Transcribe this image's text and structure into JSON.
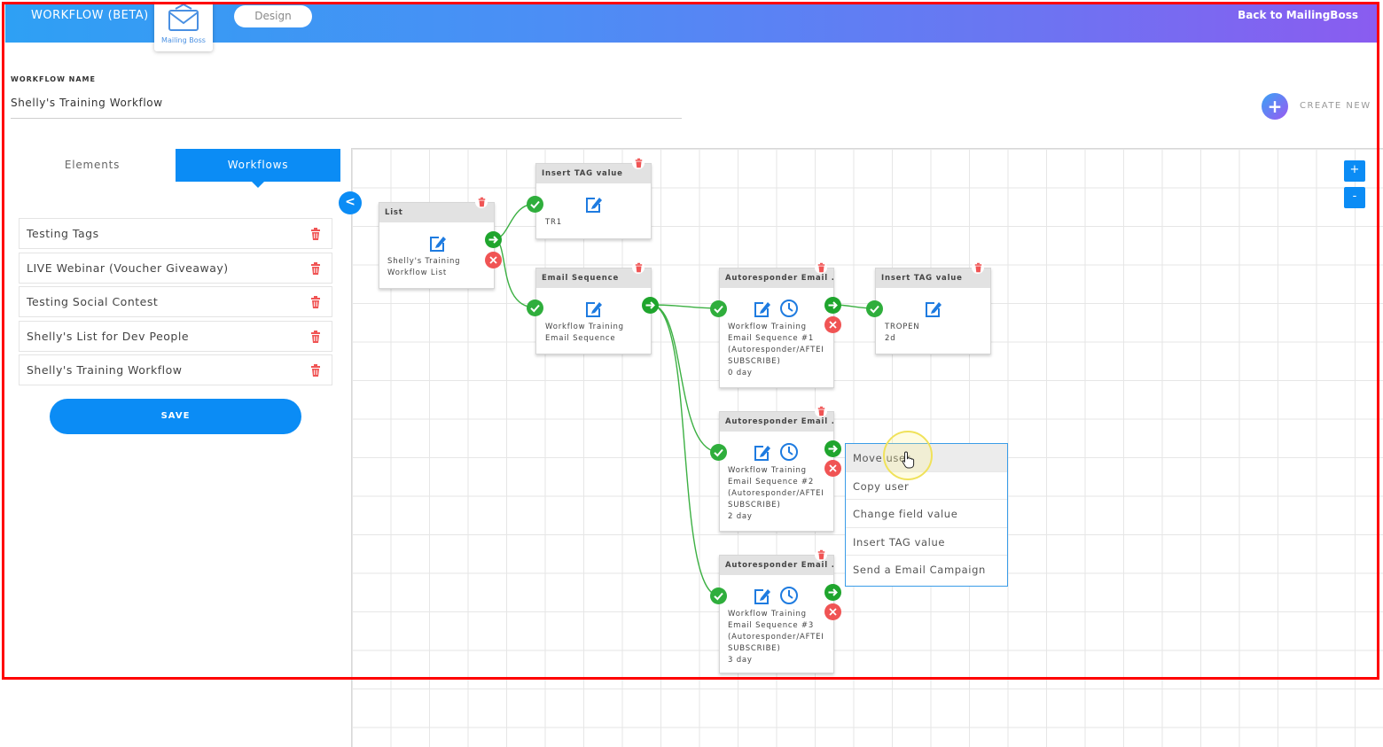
{
  "header": {
    "app_title": "WORKFLOW (BETA)",
    "logo_text": "Mailing Boss",
    "design_label": "Design",
    "back_link": "Back to MailingBoss"
  },
  "workflow": {
    "name_label": "WORKFLOW NAME",
    "name_value": "Shelly's Training Workflow"
  },
  "create_new_label": "CREATE NEW",
  "sidebar": {
    "tabs": [
      {
        "label": "Elements",
        "active": false
      },
      {
        "label": "Workflows",
        "active": true
      }
    ],
    "workflows": [
      {
        "label": "Testing Tags"
      },
      {
        "label": "LIVE Webinar (Voucher Giveaway)"
      },
      {
        "label": "Testing Social Contest"
      },
      {
        "label": "Shelly's List for Dev People"
      },
      {
        "label": "Shelly's Training Workflow"
      }
    ],
    "save_label": "SAVE",
    "collapse_label": "<"
  },
  "canvas": {
    "zoom_in": "+",
    "zoom_out": "-",
    "nodes": [
      {
        "id": "list",
        "title": "List",
        "lines": [
          "Shelly's Training",
          "Workflow List"
        ]
      },
      {
        "id": "tag1",
        "title": "Insert TAG value",
        "lines": [
          "TR1"
        ]
      },
      {
        "id": "seq",
        "title": "Email Sequence",
        "lines": [
          "Workflow Training",
          "Email Sequence"
        ]
      },
      {
        "id": "ar1",
        "title": "Autoresponder Email ...",
        "lines": [
          "Workflow Training",
          "Email Sequence #1",
          "(Autoresponder/AFTEI",
          "SUBSCRIBE)",
          "0 day"
        ]
      },
      {
        "id": "tag2",
        "title": "Insert TAG value",
        "lines": [
          "TROPEN",
          "2d"
        ]
      },
      {
        "id": "ar2",
        "title": "Autoresponder Email ...",
        "lines": [
          "Workflow Training",
          "Email Sequence #2",
          "(Autoresponder/AFTEI",
          "SUBSCRIBE)",
          "2 day"
        ]
      },
      {
        "id": "ar3",
        "title": "Autoresponder Email ...",
        "lines": [
          "Workflow Training",
          "Email Sequence #3",
          "(Autoresponder/AFTEI",
          "SUBSCRIBE)",
          "3 day"
        ]
      }
    ]
  },
  "context_menu": {
    "items": [
      {
        "label": "Move user",
        "active": true
      },
      {
        "label": "Copy user",
        "active": false
      },
      {
        "label": "Change field value",
        "active": false
      },
      {
        "label": "Insert TAG value",
        "active": false
      },
      {
        "label": "Send a Email Campaign",
        "active": false
      }
    ]
  },
  "colors": {
    "accent": "#0b8cf5",
    "success": "#2fae3c",
    "danger": "#f05454",
    "frame": "#ff0000"
  }
}
